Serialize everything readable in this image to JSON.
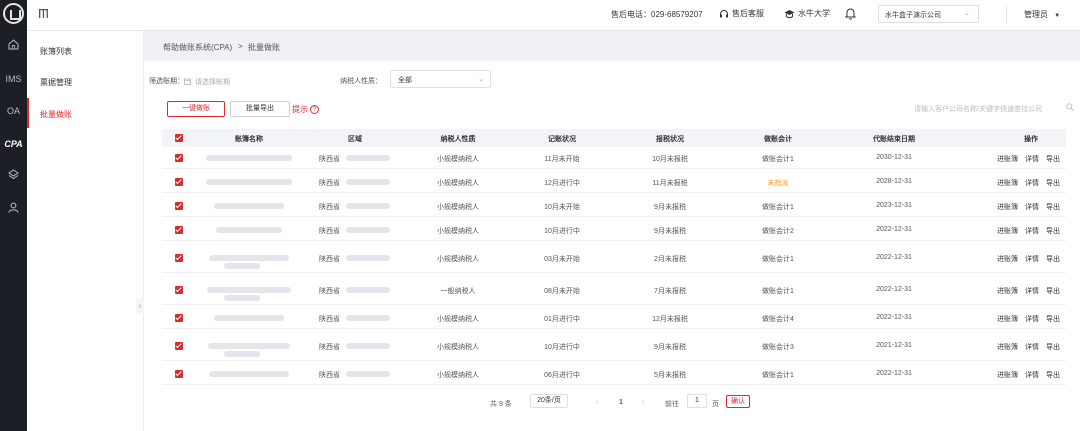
{
  "rail": {
    "items": [
      "IMS",
      "OA",
      "CPA"
    ]
  },
  "topbar": {
    "hotline": "售后电话：029-68579207",
    "service": "售后客服",
    "university": "水牛大学",
    "company": "水牛盒子演示公司",
    "admin": "管理员"
  },
  "sidebar": {
    "items": [
      {
        "label": "账簿列表",
        "active": false
      },
      {
        "label": "票据管理",
        "active": false
      },
      {
        "label": "批量做账",
        "active": true
      }
    ]
  },
  "breadcrumb": {
    "parent": "帮助做账系统(CPA)",
    "separator": ">",
    "current": "批量做账"
  },
  "filters": {
    "period_label": "筛选账期：",
    "period_placeholder": "请选择账期",
    "taxpayer_label": "纳税人性质：",
    "taxpayer_value": "全部"
  },
  "actions": {
    "one_click": "一键做账",
    "batch_export": "批量导出",
    "hint": "提示",
    "search_placeholder": "请输入客户公司名称/关键字快速查找公司"
  },
  "table": {
    "headers": [
      "账簿名称",
      "区域",
      "纳税人性质",
      "记账状况",
      "报税状况",
      "做账会计",
      "代账结束日期",
      "操作"
    ],
    "ops": [
      "进账簿",
      "详情",
      "导出"
    ],
    "rows": [
      {
        "region": "陕西省",
        "type": "小规模纳税人",
        "bookkeeping": "11月未开始",
        "tax": "10月未报税",
        "accountant": "做账会计1",
        "end": "2030-12-31",
        "orange": false,
        "tall": false
      },
      {
        "region": "陕西省",
        "type": "小规模纳税人",
        "bookkeeping": "12月进行中",
        "tax": "11月未报税",
        "accountant": "未指派",
        "end": "2028-12-31",
        "orange": true,
        "tall": false
      },
      {
        "region": "陕西省",
        "type": "小规模纳税人",
        "bookkeeping": "10月未开始",
        "tax": "9月未报税",
        "accountant": "做账会计1",
        "end": "2023-12-31",
        "orange": false,
        "tall": false
      },
      {
        "region": "陕西省",
        "type": "小规模纳税人",
        "bookkeeping": "10月进行中",
        "tax": "9月未报税",
        "accountant": "做账会计2",
        "end": "2022-12-31",
        "orange": false,
        "tall": false
      },
      {
        "region": "陕西省",
        "type": "小规模纳税人",
        "bookkeeping": "03月未开始",
        "tax": "2月未报税",
        "accountant": "做账会计1",
        "end": "2022-12-31",
        "orange": false,
        "tall": true
      },
      {
        "region": "陕西省",
        "type": "一般纳税人",
        "bookkeeping": "08月未开始",
        "tax": "7月未报税",
        "accountant": "做账会计1",
        "end": "2022-12-31",
        "orange": false,
        "tall": true
      },
      {
        "region": "陕西省",
        "type": "小规模纳税人",
        "bookkeeping": "01月进行中",
        "tax": "12月未报税",
        "accountant": "做账会计4",
        "end": "2022-12-31",
        "orange": false,
        "tall": false
      },
      {
        "region": "陕西省",
        "type": "小规模纳税人",
        "bookkeeping": "10月进行中",
        "tax": "9月未报税",
        "accountant": "做账会计3",
        "end": "2021-12-31",
        "orange": false,
        "tall": true
      },
      {
        "region": "陕西省",
        "type": "小规模纳税人",
        "bookkeeping": "06月进行中",
        "tax": "5月未报税",
        "accountant": "做账会计1",
        "end": "2022-12-31",
        "orange": false,
        "tall": false
      }
    ]
  },
  "pagination": {
    "total": "共 9 条",
    "page_size": "20条/页",
    "prev": "‹",
    "current": "1",
    "next": "›",
    "goto_label": "前往",
    "goto_value": "1",
    "page_unit": "页",
    "confirm": "确认"
  },
  "colors": {
    "accent": "#e0282e",
    "rail": "#1d1f26",
    "warning": "#f39c12"
  }
}
